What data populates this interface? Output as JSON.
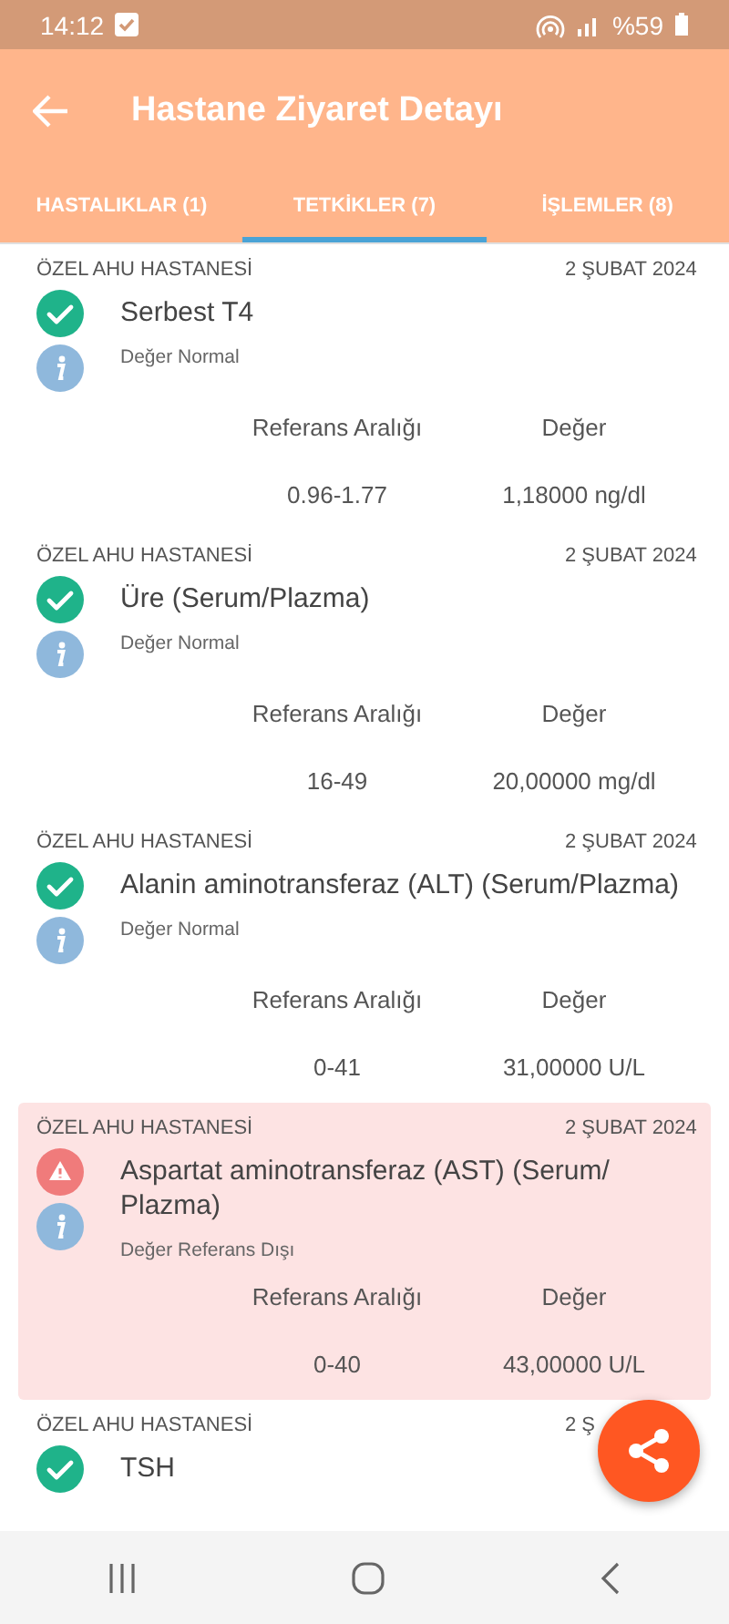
{
  "status_bar": {
    "time": "14:12",
    "battery": "%59"
  },
  "app_bar": {
    "title": "Hastane Ziyaret Detayı"
  },
  "tabs": [
    {
      "label": "HASTALIKLAR (1)",
      "selected": false
    },
    {
      "label": "TETKİKLER (7)",
      "selected": true
    },
    {
      "label": "İŞLEMLER (8)",
      "selected": false
    }
  ],
  "tests": [
    {
      "hospital": "ÖZEL AHU HASTANESİ",
      "date": "2 ŞUBAT 2024",
      "name": "Serbest T4",
      "kind": "normal",
      "status": "Değer Normal",
      "range_label": "Referans Aralığı",
      "value_label": "Değer",
      "range": "0.96-1.77",
      "value": "1,18000 ng/dl"
    },
    {
      "hospital": "ÖZEL AHU HASTANESİ",
      "date": "2 ŞUBAT 2024",
      "name": "Üre (Serum/Plazma)",
      "kind": "normal",
      "status": "Değer Normal",
      "range_label": "Referans Aralığı",
      "value_label": "Değer",
      "range": "16-49",
      "value": "20,00000 mg/dl"
    },
    {
      "hospital": "ÖZEL AHU HASTANESİ",
      "date": "2 ŞUBAT 2024",
      "name": "Alanin aminotransferaz (ALT) (Serum/Plazma)",
      "kind": "normal",
      "status": "Değer Normal",
      "range_label": "Referans Aralığı",
      "value_label": "Değer",
      "range": "0-41",
      "value": "31,00000 U/L"
    },
    {
      "hospital": "ÖZEL AHU HASTANESİ",
      "date": "2 ŞUBAT 2024",
      "name": "Aspartat aminotransferaz (AST) (Serum/ Plazma)",
      "kind": "abnormal",
      "status": "Değer Referans Dışı",
      "range_label": "Referans Aralığı",
      "value_label": "Değer",
      "range": "0-40",
      "value": "43,00000 U/L"
    },
    {
      "hospital": "ÖZEL AHU HASTANESİ",
      "date": "2 Ş",
      "name": "TSH",
      "kind": "normal"
    }
  ]
}
